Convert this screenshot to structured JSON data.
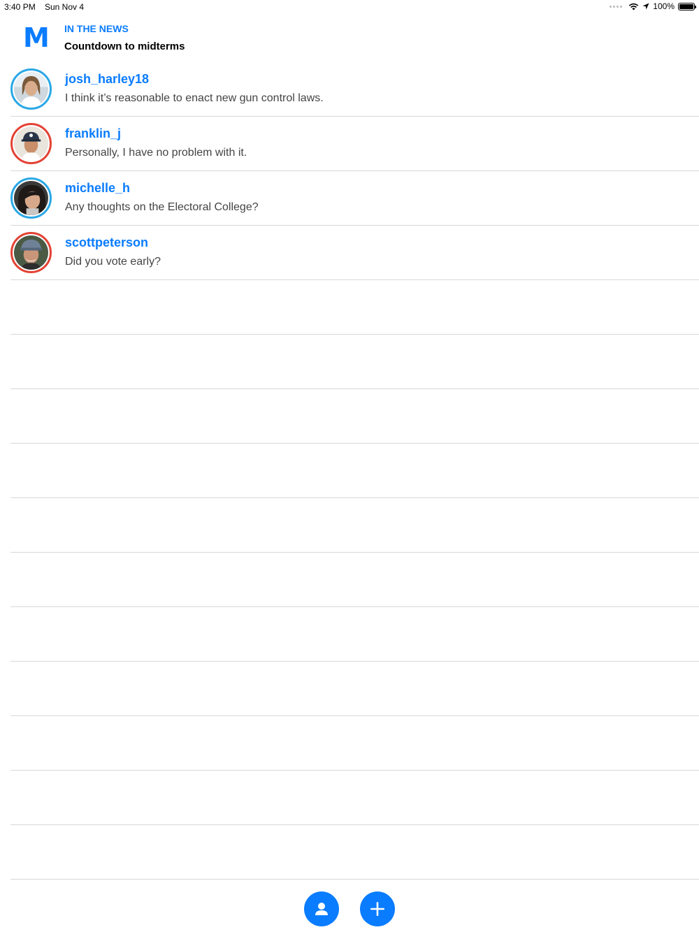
{
  "status_bar": {
    "time": "3:40 PM",
    "date": "Sun Nov 4",
    "battery": "100%",
    "icons": [
      "signal-dots-icon",
      "wifi-icon",
      "location-arrow-icon",
      "battery-icon"
    ]
  },
  "header": {
    "logo": "M",
    "kicker": "IN THE NEWS",
    "title": "Countdown to midterms"
  },
  "threads": [
    {
      "username": "josh_harley18",
      "message": "I think it’s reasonable to enact new gun control laws.",
      "ring_color": "#2aa8e6"
    },
    {
      "username": "franklin_j",
      "message": "Personally, I have no problem with it.",
      "ring_color": "#e34234"
    },
    {
      "username": "michelle_h",
      "message": "Any thoughts on the Electoral College?",
      "ring_color": "#2aa8e6"
    },
    {
      "username": "scottpeterson",
      "message": "Did you vote early?",
      "ring_color": "#e34234"
    }
  ],
  "bottom_bar": {
    "buttons": [
      "profile-icon",
      "add-icon"
    ]
  },
  "colors": {
    "accent": "#0a7cff",
    "ring_blue": "#2aa8e6",
    "ring_red": "#e34234",
    "divider": "#d8d8d8"
  }
}
